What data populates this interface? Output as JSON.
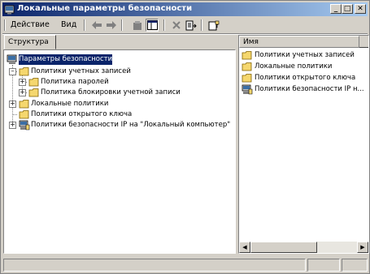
{
  "window": {
    "title": "Локальные параметры безопасности",
    "min_label": "_",
    "max_label": "□",
    "close_label": "✕"
  },
  "menu": {
    "action": "Действие",
    "view": "Вид"
  },
  "toolbar": {
    "icons": [
      "back-arrow-icon",
      "forward-arrow-icon",
      "up-folder-icon",
      "show-tree-icon",
      "delete-icon",
      "export-list-icon",
      "help-icon"
    ]
  },
  "tabs": {
    "structure": "Структура"
  },
  "tree": {
    "root": "Параметры безопасности",
    "account_policies": "Политики учетных записей",
    "password_policy": "Политика паролей",
    "lockout_policy": "Политика блокировки учетной записи",
    "local_policies": "Локальные политики",
    "public_key_policies": "Политики открытого ключа",
    "ipsec_policies": "Политики безопасности IP на \"Локальный компьютер\""
  },
  "list": {
    "column_name": "Имя",
    "items": [
      "Политики учетных записей",
      "Локальные политики",
      "Политики открытого ключа",
      "Политики безопасности IP н..."
    ]
  },
  "colors": {
    "title_start": "#0a246a",
    "title_end": "#a6caf0",
    "selection": "#0a246a",
    "folder": "#f5d76e"
  }
}
